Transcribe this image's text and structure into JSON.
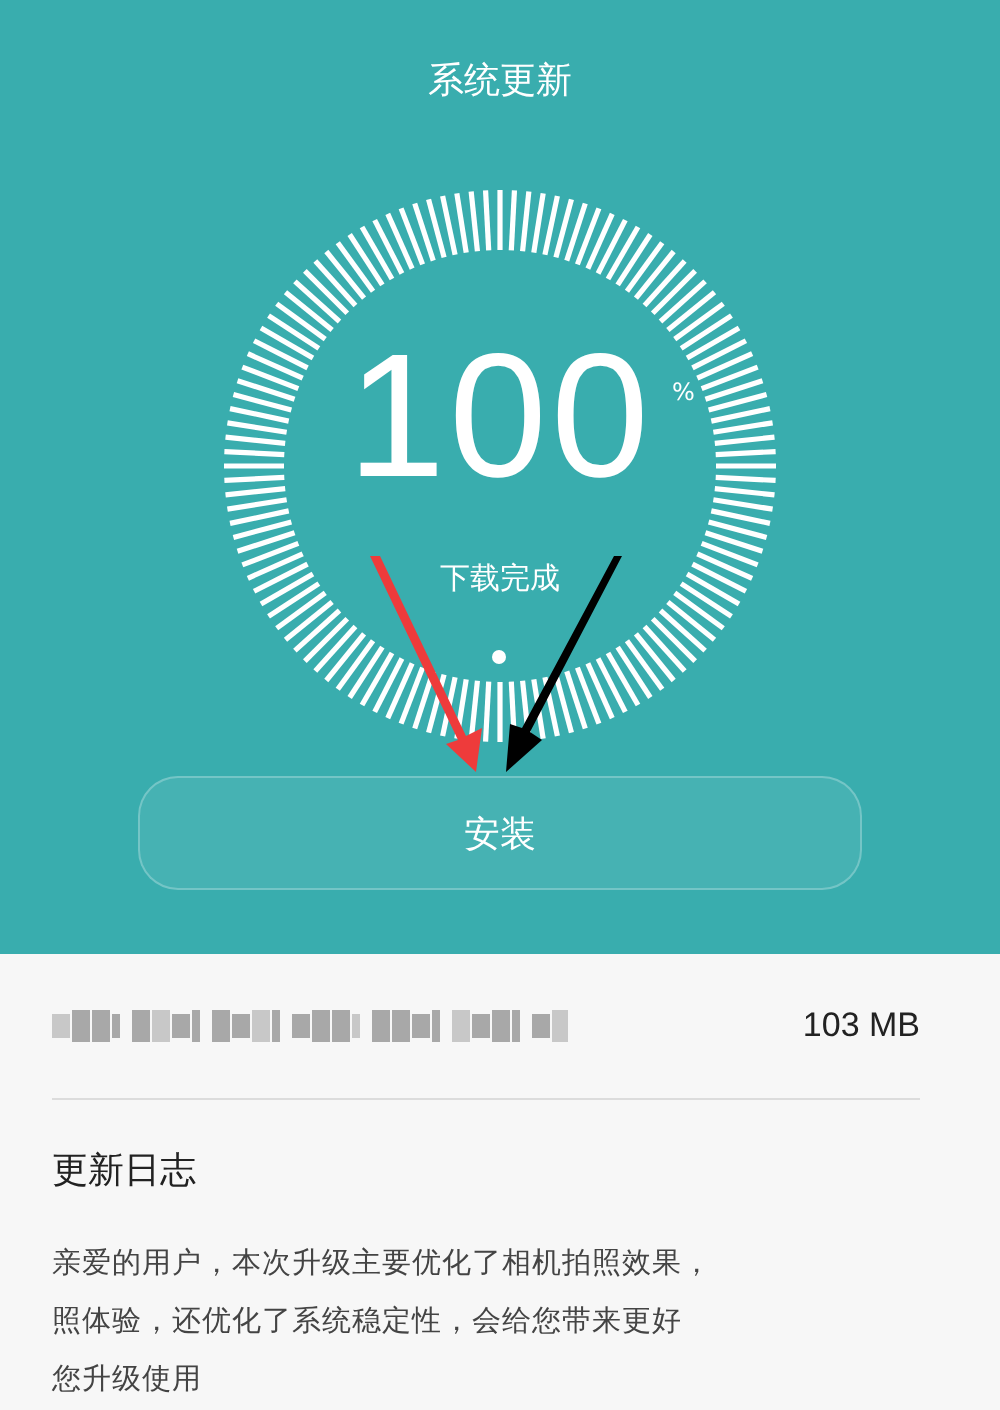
{
  "title": "系统更新",
  "progress": {
    "value": "100",
    "unit": "%",
    "status": "下载完成"
  },
  "install_button": "安装",
  "package": {
    "size": "103 MB"
  },
  "changelog": {
    "heading": "更新日志",
    "lines": [
      "亲爱的用户，本次升级主要优化了相机拍照效果，",
      "照体验，还优化了系统稳定性，会给您带来更好",
      "您升级使用"
    ]
  }
}
